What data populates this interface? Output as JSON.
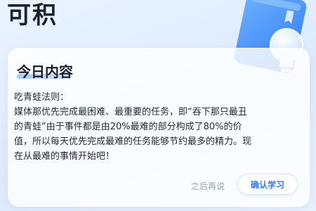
{
  "header": {
    "title": "可积"
  },
  "card": {
    "title": "今日内容",
    "lines": [
      "吃青蛙法则：",
      "媒体那优先完成最困难、最重要的任务，即“吞下那只最丑",
      "的青蛙”由于事件都是由20%最难的部分构成了80%的价",
      "值，所以每天优先完成最难的任务能够节约最多的精力。现",
      "在从最难的事情开始吧！"
    ]
  },
  "actions": {
    "later_label": "之后再说",
    "confirm_label": "确认学习"
  },
  "icons": {
    "decoration": [
      "book-icon",
      "lightbulb-icon"
    ]
  },
  "colors": {
    "accent": "#2f7cf6",
    "book": "#3d8cf5",
    "muted_text": "#9aa3b2"
  }
}
